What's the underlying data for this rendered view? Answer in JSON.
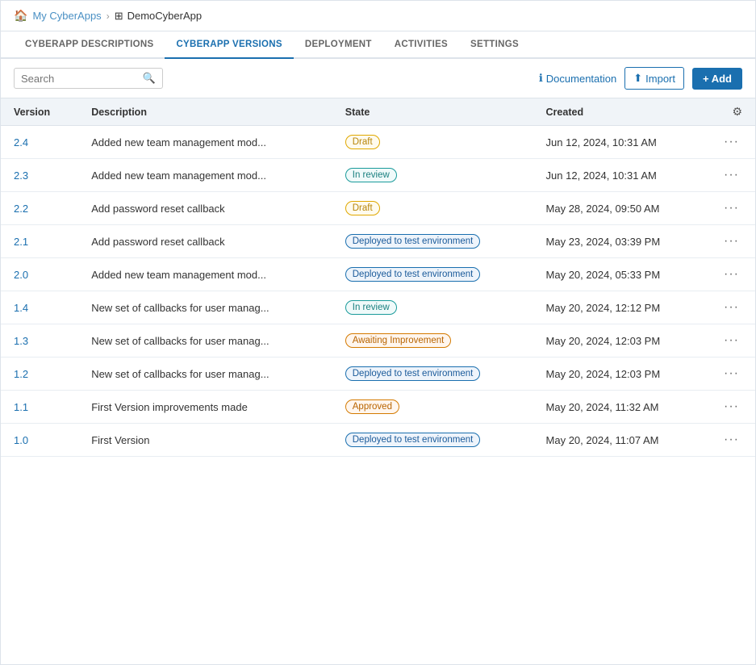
{
  "breadcrumb": {
    "home_label": "My CyberApps",
    "separator": "›",
    "current_label": "DemoCyberApp"
  },
  "nav_tabs": [
    {
      "id": "descriptions",
      "label": "CyberApp Descriptions",
      "active": false
    },
    {
      "id": "versions",
      "label": "CyberApp Versions",
      "active": true
    },
    {
      "id": "deployment",
      "label": "Deployment",
      "active": false
    },
    {
      "id": "activities",
      "label": "Activities",
      "active": false
    },
    {
      "id": "settings",
      "label": "Settings",
      "active": false
    }
  ],
  "toolbar": {
    "search_placeholder": "Search",
    "docs_label": "Documentation",
    "import_label": "Import",
    "add_label": "+ Add"
  },
  "table": {
    "columns": [
      "Version",
      "Description",
      "State",
      "Created"
    ],
    "rows": [
      {
        "version": "2.4",
        "description": "Added new team management mod...",
        "state": "Draft",
        "state_type": "draft",
        "created": "Jun 12, 2024, 10:31 AM"
      },
      {
        "version": "2.3",
        "description": "Added new team management mod...",
        "state": "In review",
        "state_type": "in-review",
        "created": "Jun 12, 2024, 10:31 AM"
      },
      {
        "version": "2.2",
        "description": "Add password reset callback",
        "state": "Draft",
        "state_type": "draft",
        "created": "May 28, 2024, 09:50 AM"
      },
      {
        "version": "2.1",
        "description": "Add password reset callback",
        "state": "Deployed to test environment",
        "state_type": "deployed",
        "created": "May 23, 2024, 03:39 PM"
      },
      {
        "version": "2.0",
        "description": "Added new team management mod...",
        "state": "Deployed to test environment",
        "state_type": "deployed",
        "created": "May 20, 2024, 05:33 PM"
      },
      {
        "version": "1.4",
        "description": "New set of callbacks for user manag...",
        "state": "In review",
        "state_type": "in-review",
        "created": "May 20, 2024, 12:12 PM"
      },
      {
        "version": "1.3",
        "description": "New set of callbacks for user manag...",
        "state": "Awaiting Improvement",
        "state_type": "awaiting",
        "created": "May 20, 2024, 12:03 PM"
      },
      {
        "version": "1.2",
        "description": "New set of callbacks for user manag...",
        "state": "Deployed to test environment",
        "state_type": "deployed",
        "created": "May 20, 2024, 12:03 PM"
      },
      {
        "version": "1.1",
        "description": "First Version improvements made",
        "state": "Approved",
        "state_type": "approved",
        "created": "May 20, 2024, 11:32 AM"
      },
      {
        "version": "1.0",
        "description": "First Version",
        "state": "Deployed to test environment",
        "state_type": "deployed",
        "created": "May 20, 2024, 11:07 AM"
      }
    ]
  }
}
